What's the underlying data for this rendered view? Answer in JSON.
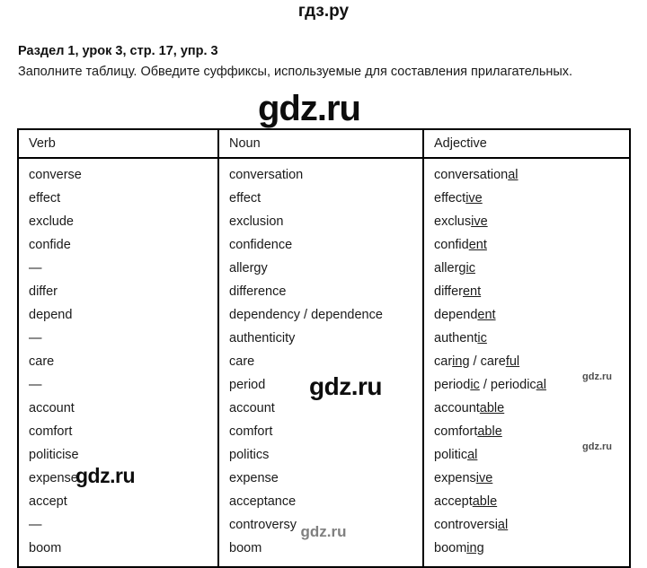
{
  "page": {
    "site_mark_top": "гдз.ру",
    "task_title": "Раздел 1, урок 3, стр. 17, упр. 3",
    "task_description": "Заполните таблицу. Обведите суффиксы, используемые для составления прилагательных."
  },
  "watermarks": {
    "big_top": "gdz.ru",
    "middle": "gdz.ru",
    "left": "gdz.ru",
    "small_right_upper": "gdz.ru",
    "small_right_lower": "gdz.ru",
    "bottom": "gdz.ru",
    "color_dark": "#0d0d0d",
    "color_gray": "#808080",
    "color_small_gray": "#4d4d4d"
  },
  "table": {
    "headers": [
      "Verb",
      "Noun",
      "Adjective"
    ],
    "rows": [
      {
        "verb": "converse",
        "noun": "conversation",
        "adjective_stem": "conversation",
        "adjective_suffix": "al",
        "adjective_tail": ""
      },
      {
        "verb": "effect",
        "noun": "effect",
        "adjective_stem": "effect",
        "adjective_suffix": "ive",
        "adjective_tail": ""
      },
      {
        "verb": "exclude",
        "noun": "exclusion",
        "adjective_stem": "exclus",
        "adjective_suffix": "ive",
        "adjective_tail": ""
      },
      {
        "verb": "confide",
        "noun": "confidence",
        "adjective_stem": "confid",
        "adjective_suffix": "ent",
        "adjective_tail": ""
      },
      {
        "verb": "—",
        "noun": "allergy",
        "adjective_stem": "allerg",
        "adjective_suffix": "ic",
        "adjective_tail": ""
      },
      {
        "verb": "differ",
        "noun": "difference",
        "adjective_stem": "differ",
        "adjective_suffix": "ent",
        "adjective_tail": ""
      },
      {
        "verb": "depend",
        "noun": "dependency / dependence",
        "adjective_stem": "depend",
        "adjective_suffix": "ent",
        "adjective_tail": ""
      },
      {
        "verb": "—",
        "noun": "authenticity",
        "adjective_stem": "authent",
        "adjective_suffix": "ic",
        "adjective_tail": ""
      },
      {
        "verb": "care",
        "noun": "care",
        "adjective_stem": "car",
        "adjective_suffix": "ing",
        "adjective_tail": " / care",
        "adjective_suffix2": "ful",
        "adjective_tail2": ""
      },
      {
        "verb": "—",
        "noun": "period",
        "adjective_stem": "period",
        "adjective_suffix": "ic",
        "adjective_tail": " / periodic",
        "adjective_suffix2": "al",
        "adjective_tail2": ""
      },
      {
        "verb": "account",
        "noun": "account",
        "adjective_stem": "account",
        "adjective_suffix": "able",
        "adjective_tail": ""
      },
      {
        "verb": "comfort",
        "noun": "comfort",
        "adjective_stem": "comfort",
        "adjective_suffix": "able",
        "adjective_tail": ""
      },
      {
        "verb": "politicise",
        "noun": "politics",
        "adjective_stem": "politic",
        "adjective_suffix": "al",
        "adjective_tail": ""
      },
      {
        "verb": "expense",
        "noun": "expense",
        "adjective_stem": "expens",
        "adjective_suffix": "ive",
        "adjective_tail": ""
      },
      {
        "verb": "accept",
        "noun": "acceptance",
        "adjective_stem": "accept",
        "adjective_suffix": "able",
        "adjective_tail": ""
      },
      {
        "verb": "—",
        "noun": "controversy",
        "adjective_stem": "controversi",
        "adjective_suffix": "al",
        "adjective_tail": ""
      },
      {
        "verb": "boom",
        "noun": "boom",
        "adjective_stem": "boom",
        "adjective_suffix": "ing",
        "adjective_tail": ""
      }
    ]
  }
}
